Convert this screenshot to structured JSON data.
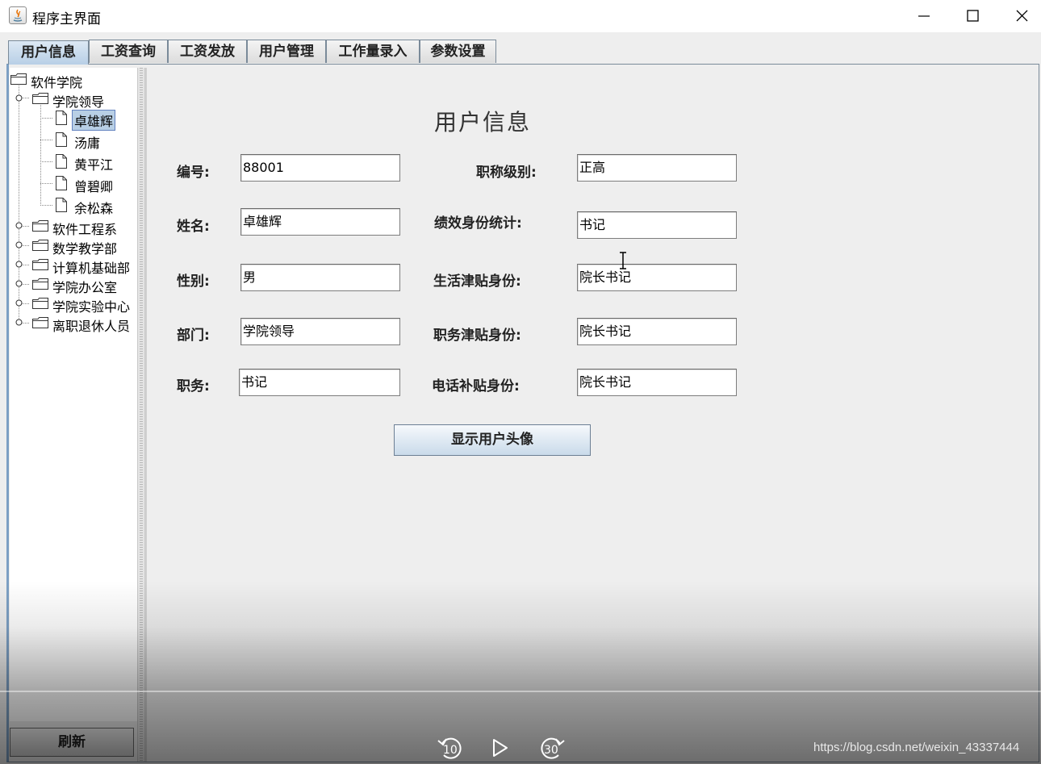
{
  "window": {
    "title": "程序主界面"
  },
  "tabs": [
    {
      "label": "用户信息",
      "active": true
    },
    {
      "label": "工资查询"
    },
    {
      "label": "工资发放"
    },
    {
      "label": "用户管理"
    },
    {
      "label": "工作量录入"
    },
    {
      "label": "参数设置"
    }
  ],
  "tree": {
    "root": "软件学院",
    "expanded_group": "学院领导",
    "leaders": [
      "卓雄辉",
      "汤庸",
      "黄平江",
      "曾碧卿",
      "余松森"
    ],
    "selected": "卓雄辉",
    "groups": [
      "软件工程系",
      "数学教学部",
      "计算机基础部",
      "学院办公室",
      "学院实验中心",
      "离职退休人员"
    ]
  },
  "refresh_label": "刷新",
  "form": {
    "title": "用户信息",
    "fields": {
      "id": {
        "label": "编号:",
        "value": "88001"
      },
      "name": {
        "label": "姓名:",
        "value": "卓雄辉"
      },
      "gender": {
        "label": "性别:",
        "value": "男"
      },
      "department": {
        "label": "部门:",
        "value": "学院领导"
      },
      "position": {
        "label": "职务:",
        "value": "书记"
      },
      "title_level": {
        "label": "职称级别:",
        "value": "正高"
      },
      "performance_identity": {
        "label": "绩效身份统计:",
        "value": "书记"
      },
      "living_allowance": {
        "label": "生活津贴身份:",
        "value": "院长书记"
      },
      "duty_allowance": {
        "label": "职务津贴身份:",
        "value": "院长书记"
      },
      "phone_allowance": {
        "label": "电话补贴身份:",
        "value": "院长书记"
      }
    },
    "show_avatar_label": "显示用户头像"
  },
  "player": {
    "rewind_seconds": "10",
    "forward_seconds": "30"
  },
  "watermark": "https://blog.csdn.net/weixin_43337444"
}
